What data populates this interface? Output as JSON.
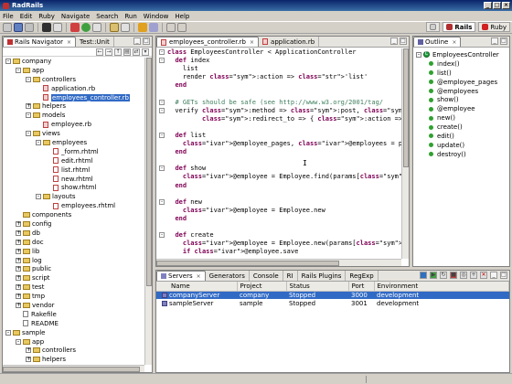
{
  "window": {
    "title": "RadRails"
  },
  "menu": [
    "File",
    "Edit",
    "Ruby",
    "Navigate",
    "Search",
    "Run",
    "Window",
    "Help"
  ],
  "perspectives": [
    {
      "label": "Rails",
      "active": true
    },
    {
      "label": "Ruby",
      "active": false
    }
  ],
  "navigator": {
    "tabs": [
      {
        "label": "Rails Navigator",
        "active": true
      },
      {
        "label": "Test::Unit",
        "active": false
      }
    ],
    "tree": [
      {
        "label": "company",
        "depth": 0,
        "type": "project",
        "toggle": "-"
      },
      {
        "label": "app",
        "depth": 1,
        "type": "folder",
        "toggle": "-"
      },
      {
        "label": "controllers",
        "depth": 2,
        "type": "folder",
        "toggle": "-"
      },
      {
        "label": "application.rb",
        "depth": 3,
        "type": "rb",
        "toggle": ""
      },
      {
        "label": "employees_controller.rb",
        "depth": 3,
        "type": "rb",
        "toggle": "",
        "selected": true
      },
      {
        "label": "helpers",
        "depth": 2,
        "type": "folder",
        "toggle": "+"
      },
      {
        "label": "models",
        "depth": 2,
        "type": "folder",
        "toggle": "-"
      },
      {
        "label": "employee.rb",
        "depth": 3,
        "type": "rb",
        "toggle": ""
      },
      {
        "label": "views",
        "depth": 2,
        "type": "folder",
        "toggle": "-"
      },
      {
        "label": "employees",
        "depth": 3,
        "type": "folder",
        "toggle": "-"
      },
      {
        "label": "_form.rhtml",
        "depth": 4,
        "type": "rhtml",
        "toggle": ""
      },
      {
        "label": "edit.rhtml",
        "depth": 4,
        "type": "rhtml",
        "toggle": ""
      },
      {
        "label": "list.rhtml",
        "depth": 4,
        "type": "rhtml",
        "toggle": ""
      },
      {
        "label": "new.rhtml",
        "depth": 4,
        "type": "rhtml",
        "toggle": ""
      },
      {
        "label": "show.rhtml",
        "depth": 4,
        "type": "rhtml",
        "toggle": ""
      },
      {
        "label": "layouts",
        "depth": 3,
        "type": "folder",
        "toggle": "-"
      },
      {
        "label": "employees.rhtml",
        "depth": 4,
        "type": "rhtml",
        "toggle": ""
      },
      {
        "label": "components",
        "depth": 1,
        "type": "folder",
        "toggle": ""
      },
      {
        "label": "config",
        "depth": 1,
        "type": "folder",
        "toggle": "+"
      },
      {
        "label": "db",
        "depth": 1,
        "type": "folder",
        "toggle": "+"
      },
      {
        "label": "doc",
        "depth": 1,
        "type": "folder",
        "toggle": "+"
      },
      {
        "label": "lib",
        "depth": 1,
        "type": "folder",
        "toggle": "+"
      },
      {
        "label": "log",
        "depth": 1,
        "type": "folder",
        "toggle": "+"
      },
      {
        "label": "public",
        "depth": 1,
        "type": "folder",
        "toggle": "+"
      },
      {
        "label": "script",
        "depth": 1,
        "type": "folder",
        "toggle": "+"
      },
      {
        "label": "test",
        "depth": 1,
        "type": "folder",
        "toggle": "+"
      },
      {
        "label": "tmp",
        "depth": 1,
        "type": "folder",
        "toggle": "+"
      },
      {
        "label": "vendor",
        "depth": 1,
        "type": "folder",
        "toggle": "+"
      },
      {
        "label": "Rakefile",
        "depth": 1,
        "type": "plain",
        "toggle": ""
      },
      {
        "label": "README",
        "depth": 1,
        "type": "plain",
        "toggle": ""
      },
      {
        "label": "sample",
        "depth": 0,
        "type": "project",
        "toggle": "-"
      },
      {
        "label": "app",
        "depth": 1,
        "type": "folder",
        "toggle": "-"
      },
      {
        "label": "controllers",
        "depth": 2,
        "type": "folder",
        "toggle": "+"
      },
      {
        "label": "helpers",
        "depth": 2,
        "type": "folder",
        "toggle": "+"
      }
    ]
  },
  "editor": {
    "tabs": [
      {
        "label": "employees_controller.rb",
        "active": true
      },
      {
        "label": "application.rb",
        "active": false
      }
    ],
    "lines": [
      "class EmployeesController < ApplicationController",
      "  def index",
      "    list",
      "    render :action => 'list'",
      "  end",
      "",
      "  # GETs should be safe (see http://www.w3.org/2001/tag/",
      "  verify :method => :post, :only => [ :destroy, :create,",
      "         :redirect_to => { :action => :list }",
      "",
      "  def list",
      "    @employee_pages, @employees = paginate :employees, :",
      "  end",
      "",
      "  def show",
      "    @employee = Employee.find(params[:id])",
      "  end",
      "",
      "  def new",
      "    @employee = Employee.new",
      "  end",
      "",
      "  def create",
      "    @employee = Employee.new(params[:employee])",
      "    if @employee.save"
    ]
  },
  "outline": {
    "tab": "Outline",
    "root": "EmployeesController",
    "items": [
      "index()",
      "list()",
      "@employee_pages",
      "@employees",
      "show()",
      "@employee",
      "new()",
      "create()",
      "edit()",
      "update()",
      "destroy()"
    ]
  },
  "bottom": {
    "tabs": [
      {
        "label": "Servers",
        "active": true
      },
      {
        "label": "Generators",
        "active": false
      },
      {
        "label": "Console",
        "active": false
      },
      {
        "label": "RI",
        "active": false
      },
      {
        "label": "Rails Plugins",
        "active": false
      },
      {
        "label": "RegExp",
        "active": false
      }
    ],
    "columns": [
      "Name",
      "Project",
      "Status",
      "Port",
      "Environment"
    ],
    "rows": [
      {
        "name": "companyServer",
        "project": "company",
        "status": "Stopped",
        "port": "3000",
        "env": "development",
        "selected": true
      },
      {
        "name": "sampleServer",
        "project": "sample",
        "status": "Stopped",
        "port": "3001",
        "env": "development",
        "selected": false
      }
    ]
  },
  "colors": {
    "selection": "#316ac5",
    "keyword": "#7f0055",
    "symbol": "#c000c0",
    "string": "#2a00ff",
    "comment": "#3f7f5f",
    "ivar": "#0000c0"
  }
}
